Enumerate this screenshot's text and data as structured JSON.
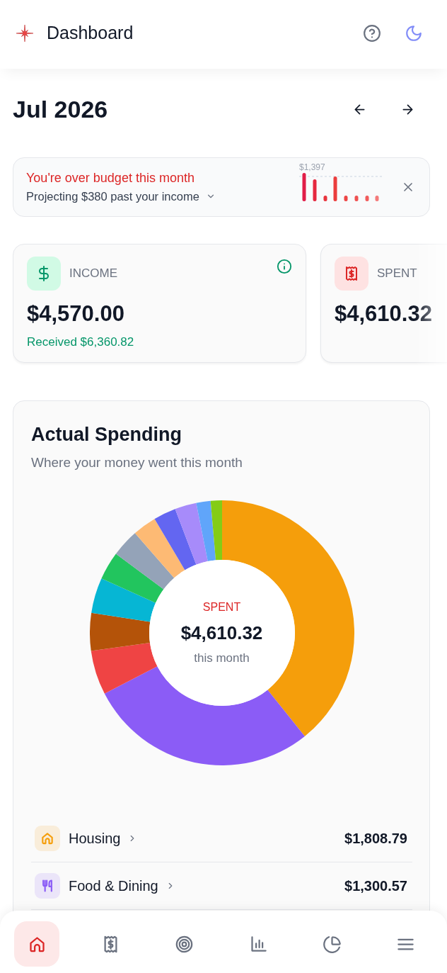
{
  "header": {
    "title": "Dashboard"
  },
  "period": {
    "label": "Jul 2026"
  },
  "alert": {
    "title": "You're over budget this month",
    "message": "Projecting $380 past your income",
    "expanded": false,
    "peak_label": "$1,397"
  },
  "stat_cards": [
    {
      "kind": "income",
      "label": "INCOME",
      "amount": "$4,570.00",
      "note": "Received $6,360.82"
    },
    {
      "kind": "spent",
      "label": "SPENT",
      "amount": "$4,610.32"
    }
  ],
  "spending": {
    "title": "Actual Spending",
    "subtitle": "Where your money went this month",
    "center": {
      "label": "SPENT",
      "amount": "$4,610.32",
      "caption": "this month"
    },
    "categories": [
      {
        "kind": "housing",
        "name": "Housing",
        "amount": "$1,808.79",
        "color": "#f59e0b"
      },
      {
        "kind": "food",
        "name": "Food & Dining",
        "amount": "$1,300.57",
        "color": "#8b5cf6"
      }
    ]
  },
  "nav": [
    {
      "kind": "home",
      "selected": true
    },
    {
      "kind": "transactions",
      "selected": false
    },
    {
      "kind": "goals",
      "selected": false
    },
    {
      "kind": "reports",
      "selected": false
    },
    {
      "kind": "budget",
      "selected": false
    },
    {
      "kind": "menu",
      "selected": false
    }
  ]
}
